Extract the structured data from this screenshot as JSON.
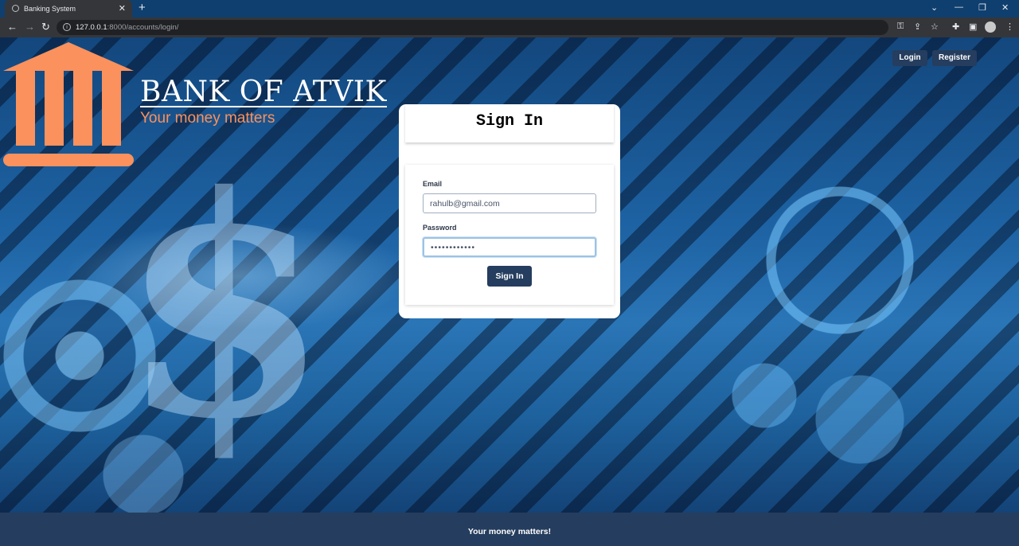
{
  "browser": {
    "tab_title": "Banking System",
    "tab_close": "✕",
    "new_tab": "+",
    "url_host": "127.0.0.1",
    "url_path": ":8000/accounts/login/",
    "window_controls": [
      "⌄",
      "—",
      "❐",
      "✕"
    ],
    "icons": [
      "key-icon",
      "share-icon",
      "star-icon",
      "puzzle-icon",
      "sidebar-icon",
      "profile-icon",
      "menu-icon"
    ]
  },
  "brand": {
    "name": "BANK OF ATVIK",
    "tagline": "Your money matters",
    "accent_color": "#fb915c"
  },
  "nav": {
    "login": "Login",
    "register": "Register"
  },
  "login_form": {
    "title": "Sign In",
    "email_label": "Email",
    "email_value": "rahulb@gmail.com",
    "password_label": "Password",
    "password_value": "••••••••••••",
    "submit_label": "Sign In"
  },
  "footer": {
    "text": "Your money matters!"
  },
  "colors": {
    "nav_button": "#253d5e",
    "footer": "#253d5e"
  }
}
